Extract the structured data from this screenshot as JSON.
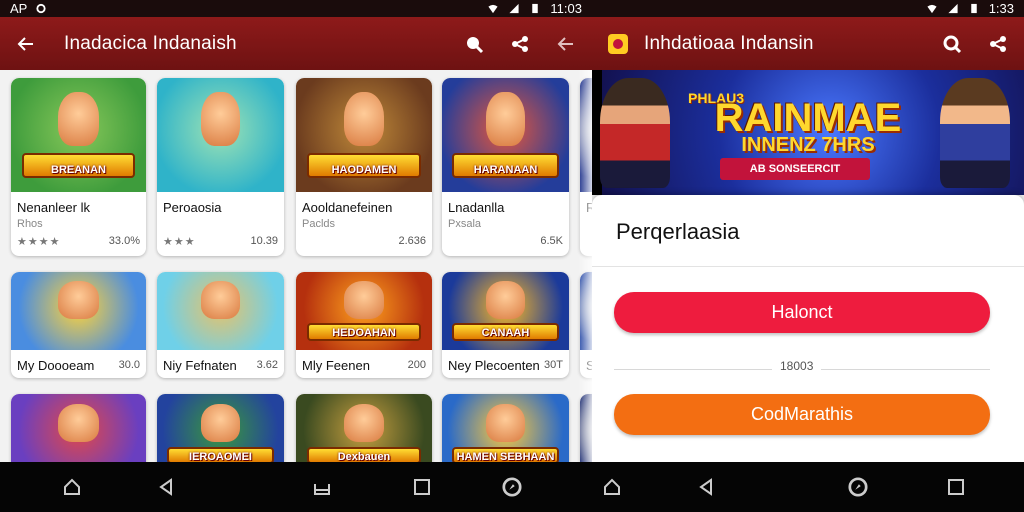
{
  "left": {
    "status": {
      "left_text": "AP",
      "time": "11:03"
    },
    "appbar": {
      "title": "Inadacica Indanaish"
    },
    "cards": [
      {
        "name": "Nenanleer lk",
        "sub": "Rhos",
        "meta": "33.0%",
        "stars": "★★★★",
        "thumb_text": "BREANAN",
        "colors": [
          "#3e9c3c",
          "#88c85a"
        ]
      },
      {
        "name": "Peroaosia",
        "sub": "",
        "meta": "10.39",
        "stars": "★★★",
        "thumb_text": "",
        "colors": [
          "#2fb3c9",
          "#9fe3b4"
        ]
      },
      {
        "name": "Aooldanefeinen",
        "sub": "Paclds",
        "meta": "2.636",
        "stars": "",
        "thumb_text": "HAODAMEN",
        "colors": [
          "#6b3b1e",
          "#c08a3a"
        ]
      },
      {
        "name": "Lnadanlla",
        "sub": "Pxsala",
        "meta": "6.5K",
        "stars": "",
        "thumb_text": "HARANAAN",
        "colors": [
          "#243d9a",
          "#e8573a"
        ]
      },
      {
        "name": "R",
        "sub": "",
        "meta": "",
        "stars": "",
        "thumb_text": "",
        "colors": [
          "#1b2f8a",
          "#e0e0e0"
        ]
      },
      {
        "name": "My Doooeam",
        "sub": "",
        "meta": "30.0",
        "stars": "",
        "thumb_text": "",
        "colors": [
          "#4a8de0",
          "#ffd33a"
        ]
      },
      {
        "name": "Niy Fefnaten",
        "sub": "",
        "meta": "3.62",
        "stars": "",
        "thumb_text": "",
        "colors": [
          "#6fd0e8",
          "#e7c26a"
        ]
      },
      {
        "name": "Mly Feenen",
        "sub": "",
        "meta": "200",
        "stars": "",
        "thumb_text": "HEDOAHAN",
        "colors": [
          "#b5300e",
          "#ffa21e"
        ]
      },
      {
        "name": "Ney Plecoenten",
        "sub": "",
        "meta": "30T",
        "stars": "",
        "thumb_text": "CANAAH",
        "colors": [
          "#1b3a9a",
          "#ffbb22"
        ]
      },
      {
        "name": "S",
        "sub": "",
        "meta": "",
        "stars": "",
        "thumb_text": "",
        "colors": [
          "#2a4ca8",
          "#dddddd"
        ]
      },
      {
        "name": "",
        "sub": "",
        "meta": "",
        "stars": "",
        "thumb_text": "",
        "colors": [
          "#6a3fc0",
          "#e24848"
        ]
      },
      {
        "name": "",
        "sub": "",
        "meta": "",
        "stars": "",
        "thumb_text": "IEROAOMEI",
        "colors": [
          "#23439e",
          "#3a9a3a"
        ]
      },
      {
        "name": "",
        "sub": "",
        "meta": "",
        "stars": "",
        "thumb_text": "Dexbauen",
        "colors": [
          "#3a4a20",
          "#c8a040"
        ]
      },
      {
        "name": "",
        "sub": "",
        "meta": "",
        "stars": "",
        "thumb_text": "HAMEN SEBHAAN",
        "colors": [
          "#2a6ac8",
          "#ffca3a"
        ]
      },
      {
        "name": "",
        "sub": "",
        "meta": "",
        "stars": "",
        "thumb_text": "",
        "colors": [
          "#1a2a70",
          "#cccccc"
        ]
      }
    ]
  },
  "right": {
    "status": {
      "time": "1:33"
    },
    "appbar": {
      "title": "Inhdatioaa Indansin"
    },
    "banner": {
      "title": "RAINMAE",
      "top_text": "PHLAU3",
      "sub": "INNENZ 7HRS",
      "tag": "AB SONSEERCIT"
    },
    "sheet": {
      "title": "Perqerlaasia",
      "primary_button": "Halonct",
      "mid_label": "18003",
      "secondary_button": "CodMarathis"
    }
  },
  "colors": {
    "appbar": "#7d1515",
    "primary": "#ee1c3e",
    "secondary": "#f36e12"
  }
}
